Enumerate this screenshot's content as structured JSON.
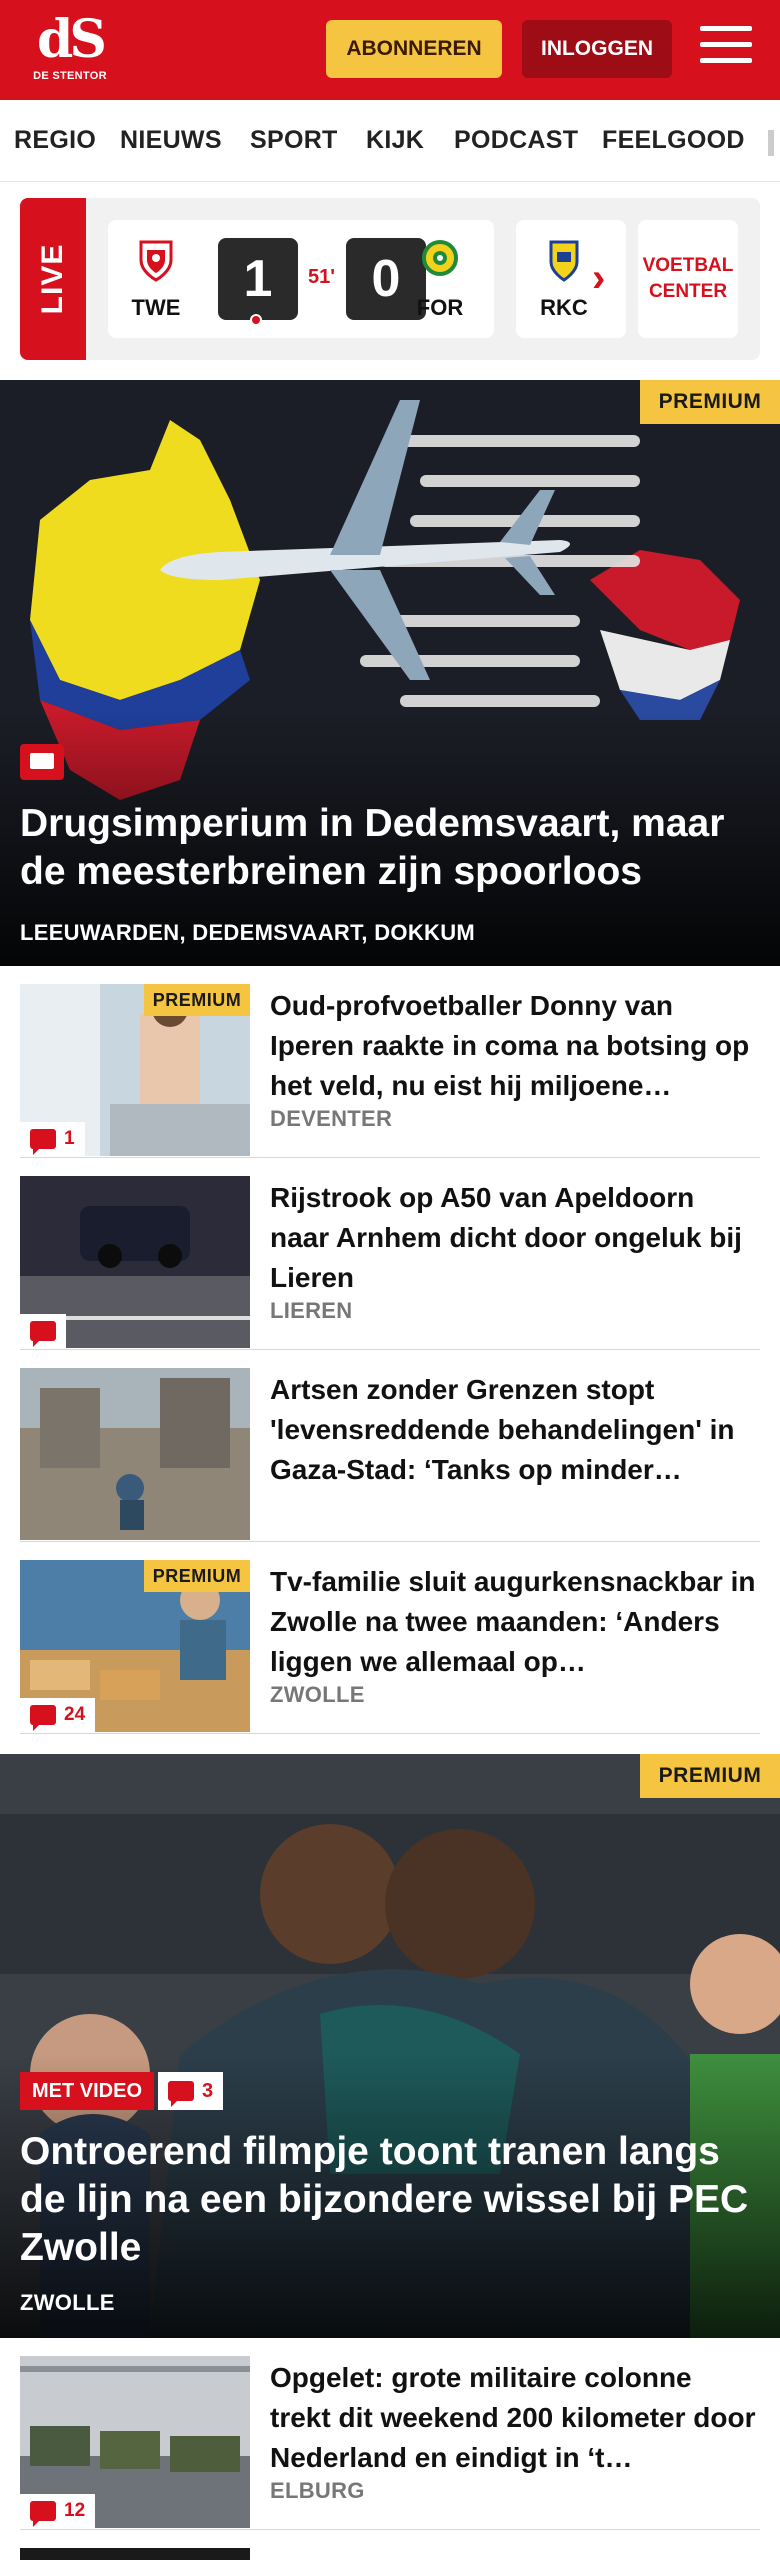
{
  "header": {
    "logo_mark": "dS",
    "logo_text": "DE STENTOR",
    "subscribe_label": "ABONNEREN",
    "login_label": "INLOGGEN",
    "brand_color": "#d6101c",
    "accent_color": "#f5c542"
  },
  "nav": {
    "items": [
      {
        "label": "REGIO"
      },
      {
        "label": "NIEUWS"
      },
      {
        "label": "SPORT"
      },
      {
        "label": "KIJK"
      },
      {
        "label": "PODCAST"
      },
      {
        "label": "FEELGOOD"
      }
    ]
  },
  "live": {
    "label": "LIVE",
    "match": {
      "home_code": "TWE",
      "away_code": "FOR",
      "home_score": "1",
      "away_score": "0",
      "minute": "51'"
    },
    "next_match_code": "RKC",
    "voetbal_center": "VOETBAL CENTER"
  },
  "hero1": {
    "premium": "PREMIUM",
    "title": "Drugsimperium in Dedemsvaart, maar de meesterbreinen zijn spoorloos",
    "location": "LEEUWARDEN, DEDEMSVAART, DOKKUM"
  },
  "articles": [
    {
      "premium": "PREMIUM",
      "comments": "1",
      "title": "Oud-profvoetballer Donny van Iperen raakte in coma na botsing op het veld, nu eist hij miljoene…",
      "location": "DEVENTER"
    },
    {
      "premium": "",
      "comments": "",
      "title": "Rijstrook op A50 van Apeldoorn naar Arnhem dicht door ongeluk bij Lieren",
      "location": "LIEREN"
    },
    {
      "premium": "",
      "comments": "",
      "title": "Artsen zonder Grenzen stopt 'levensreddende behandelingen' in Gaza-Stad: ‘Tanks op minder…",
      "location": ""
    },
    {
      "premium": "PREMIUM",
      "comments": "24",
      "title": "Tv-familie sluit augurkensnack­bar in Zwolle na twee maanden: ‘Anders liggen we allemaal op…",
      "location": "ZWOLLE"
    }
  ],
  "hero2": {
    "premium": "PREMIUM",
    "video_label": "MET VIDEO",
    "comments": "3",
    "title": "Ontroerend filmpje toont tranen langs de lijn na een bijzondere wissel bij PEC Zwolle",
    "location": "ZWOLLE"
  },
  "article5": {
    "comments": "12",
    "title": "Opgelet: grote militaire colonne trekt dit weekend 200 kilometer door Nederland en eindigt in ‘t…",
    "location": "ELBURG"
  }
}
